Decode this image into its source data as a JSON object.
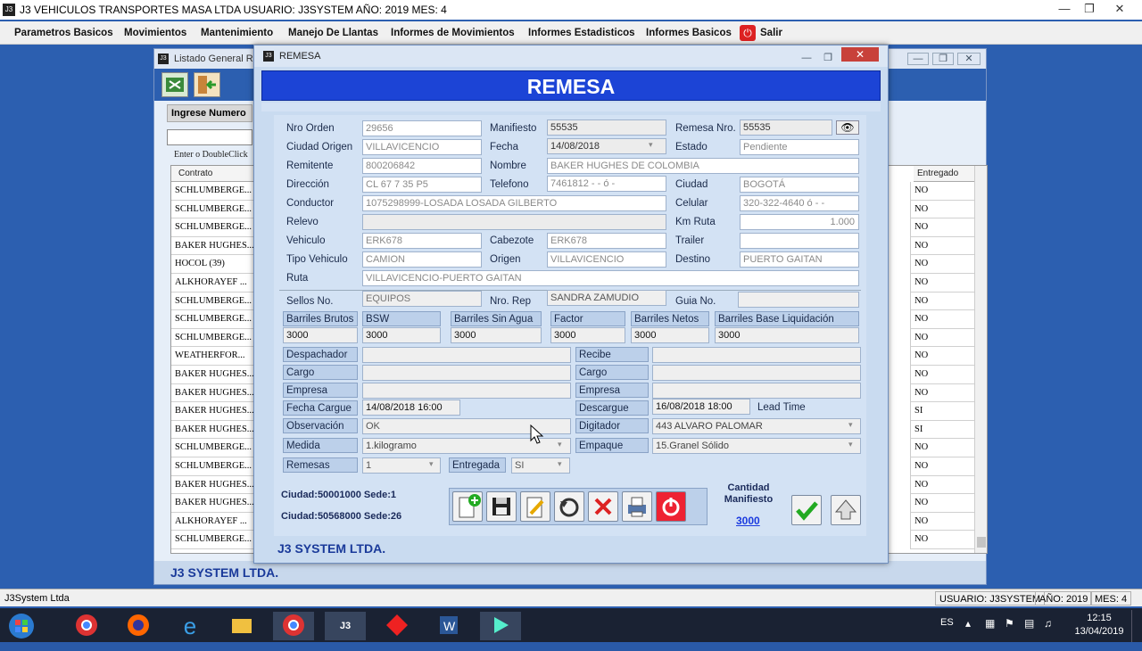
{
  "app": {
    "title": "J3 VEHICULOS TRANSPORTES MASA LTDA USUARIO: J3SYSTEM AÑO: 2019 MES: 4",
    "logo": "J3",
    "menus": [
      "Parametros Basicos",
      "Movimientos",
      "Mantenimiento",
      "Manejo De Llantas",
      "Informes de Movimientos",
      "Informes Estadisticos",
      "Informes Basicos",
      "Salir"
    ],
    "status_left": "J3System Ltda",
    "status_user": "USUARIO: J3SYSTEM",
    "status_year": "AÑO: 2019",
    "status_month": "MES: 4"
  },
  "listado": {
    "title": "Listado General Re",
    "ingrese_label": "Ingrese Numero",
    "enter_hint": "Enter o DoubleClick",
    "col_contrato": "Contrato",
    "col_entregado": "Entregado",
    "rows": [
      {
        "contrato": "SCHLUMBERGE...",
        "entregado": "NO"
      },
      {
        "contrato": "SCHLUMBERGE...",
        "entregado": "NO"
      },
      {
        "contrato": "SCHLUMBERGE...",
        "entregado": "NO"
      },
      {
        "contrato": "BAKER HUGHES...",
        "entregado": "NO"
      },
      {
        "contrato": "HOCOL (39)",
        "entregado": "NO"
      },
      {
        "contrato": "ALKHORAYEF ...",
        "entregado": "NO"
      },
      {
        "contrato": "SCHLUMBERGE...",
        "entregado": "NO"
      },
      {
        "contrato": "SCHLUMBERGE...",
        "entregado": "NO"
      },
      {
        "contrato": "SCHLUMBERGE...",
        "entregado": "NO"
      },
      {
        "contrato": "WEATHERFOR...",
        "entregado": "NO"
      },
      {
        "contrato": "BAKER HUGHES...",
        "entregado": "NO"
      },
      {
        "contrato": "BAKER HUGHES...",
        "entregado": "NO"
      },
      {
        "contrato": "BAKER HUGHES...",
        "entregado": "SI"
      },
      {
        "contrato": "BAKER HUGHES...",
        "entregado": "SI"
      },
      {
        "contrato": "SCHLUMBERGE...",
        "entregado": "NO"
      },
      {
        "contrato": "SCHLUMBERGE...",
        "entregado": "NO"
      },
      {
        "contrato": "BAKER HUGHES...",
        "entregado": "NO"
      },
      {
        "contrato": "BAKER HUGHES...",
        "entregado": "NO"
      },
      {
        "contrato": "ALKHORAYEF ...",
        "entregado": "NO"
      },
      {
        "contrato": "SCHLUMBERGE...",
        "entregado": "NO"
      }
    ],
    "footer": "J3 SYSTEM LTDA."
  },
  "remesa": {
    "window_title": "REMESA",
    "banner": "REMESA",
    "labels": {
      "nro_orden": "Nro Orden",
      "manifiesto": "Manifiesto",
      "remesa_nro": "Remesa Nro.",
      "ciudad_origen": "Ciudad Origen",
      "fecha": "Fecha",
      "estado": "Estado",
      "remitente": "Remitente",
      "nombre": "Nombre",
      "direccion": "Dirección",
      "telefono": "Telefono",
      "ciudad": "Ciudad",
      "conductor": "Conductor",
      "celular": "Celular",
      "relevo": "Relevo",
      "km_ruta": "Km Ruta",
      "vehiculo": "Vehiculo",
      "cabezote": "Cabezote",
      "trailer": "Trailer",
      "tipo_vehiculo": "Tipo Vehiculo",
      "origen": "Origen",
      "destino": "Destino",
      "ruta": "Ruta",
      "sellos": "Sellos No.",
      "nro_rep": "Nro. Rep",
      "guia": "Guia No.",
      "barriles_brutos": "Barriles Brutos",
      "bsw": "BSW",
      "barriles_sin_agua": "Barriles Sin Agua",
      "factor": "Factor",
      "barriles_netos": "Barriles Netos",
      "barriles_base": "Barriles Base Liquidación",
      "despachador": "Despachador",
      "cargo": "Cargo",
      "empresa": "Empresa",
      "recibe": "Recibe",
      "fecha_cargue": "Fecha Cargue",
      "descargue": "Descargue",
      "lead_time": "Lead Time",
      "observacion": "Observación",
      "digitador": "Digitador",
      "medida": "Medida",
      "empaque": "Empaque",
      "remesas": "Remesas",
      "entregada": "Entregada"
    },
    "values": {
      "nro_orden": "29656",
      "manifiesto": "55535",
      "remesa_nro": "55535",
      "ciudad_origen": "VILLAVICENCIO",
      "fecha": "14/08/2018",
      "estado": "Pendiente",
      "remitente": "800206842",
      "nombre": "BAKER HUGHES DE COLOMBIA",
      "direccion": "CL 67 7 35 P5",
      "telefono": "7461812    -    -    ó    -",
      "ciudad": "BOGOTÁ",
      "conductor": "1075298999-LOSADA LOSADA GILBERTO",
      "celular": "320-322-4640 ó    -    -",
      "relevo": "",
      "km_ruta": "1.000",
      "vehiculo": "ERK678",
      "cabezote": "ERK678",
      "trailer": "",
      "tipo_vehiculo": "CAMION",
      "origen": "VILLAVICENCIO",
      "destino": "PUERTO GAITAN",
      "ruta": "VILLAVICENCIO-PUERTO GAITAN",
      "sellos": "EQUIPOS",
      "nro_rep": "SANDRA ZAMUDIO",
      "guia": "",
      "barriles_brutos": "3000",
      "bsw": "3000",
      "barriles_sin_agua": "3000",
      "factor": "3000",
      "barriles_netos": "3000",
      "barriles_base": "3000",
      "fecha_cargue": "14/08/2018 16:00",
      "descargue": "16/08/2018 18:00",
      "observacion": "OK",
      "digitador": "443    ALVARO PALOMAR",
      "medida": "1.kilogramo",
      "empaque": "15.Granel Sólido",
      "remesas": "1",
      "entregada": "SI"
    },
    "ciudad1": "Ciudad:50001000 Sede:1",
    "ciudad2": "Ciudad:50568000 Sede:26",
    "cantidad_label": "Cantidad Manifiesto",
    "cantidad_value": "3000",
    "footer": "J3 SYSTEM LTDA."
  },
  "taskbar": {
    "lang": "ES",
    "time": "12:15",
    "date": "13/04/2019"
  }
}
